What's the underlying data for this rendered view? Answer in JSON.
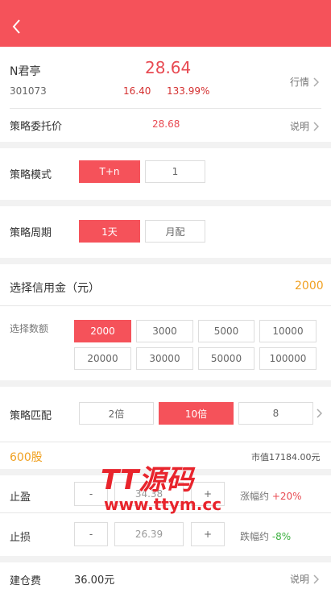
{
  "stock": {
    "name": "N君亭",
    "price": "28.64",
    "code": "301073",
    "change": "16.40",
    "change_pct": "133.99%",
    "quote_link": "行情"
  },
  "entrust": {
    "label": "策略委托价",
    "value": "28.68",
    "link": "说明"
  },
  "mode": {
    "label": "策略模式",
    "options": [
      "T+n",
      "1"
    ],
    "selected": "T+n"
  },
  "period": {
    "label": "策略周期",
    "options": [
      "1天",
      "月配"
    ],
    "selected": "1天"
  },
  "credit": {
    "label": "选择信用金（元）",
    "value": "2000",
    "qty_label": "选择数额",
    "options": [
      "2000",
      "3000",
      "5000",
      "10000",
      "20000",
      "30000",
      "50000",
      "100000"
    ],
    "selected": "2000"
  },
  "match": {
    "label": "策略匹配",
    "options": [
      "2倍",
      "10倍",
      "8"
    ],
    "selected": "10倍",
    "shares": "600股",
    "market_value": "市值17184.00元"
  },
  "take_profit": {
    "label": "止盈",
    "minus": "-",
    "value": "34.38",
    "plus": "+",
    "hint_label": "涨幅约",
    "hint_value": "+20%"
  },
  "stop_loss": {
    "label": "止损",
    "minus": "-",
    "value": "26.39",
    "plus": "+",
    "hint_label": "跌幅约",
    "hint_value": "-8%"
  },
  "fee": {
    "label": "建仓费",
    "value": "36.00元",
    "link": "说明"
  },
  "watermark": {
    "line1": "TT源码",
    "line2": "www.ttym.cc"
  },
  "colors": {
    "accent": "#f5525a",
    "orange": "#f0a020",
    "green": "#3cb040"
  },
  "icons": {
    "back": "chevron-left-icon",
    "chevron": "chevron-right-icon"
  }
}
